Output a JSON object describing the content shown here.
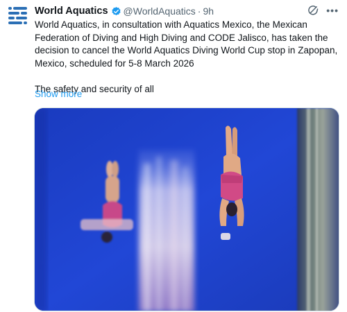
{
  "post": {
    "author_name": "World Aquatics",
    "handle": "@WorldAquatics",
    "separator": "·",
    "time": "9h",
    "paragraph_1": "World Aquatics, in consultation with Aquatics Mexico, the Mexican Federation of Diving and High Diving and CODE Jalisco, has taken the decision to cancel the World Aquatics Diving World Cup stop in Zapopan, Mexico, scheduled for 5-8 March 2026",
    "paragraph_2": "The safety and security of all",
    "show_more": "Show more"
  },
  "icons": {
    "avatar": "world-aquatics-logo",
    "verified": "verified-badge-icon",
    "grok": "grok-icon",
    "more": "more-icon"
  },
  "colors": {
    "link": "#1d9bf0",
    "verified": "#1d9bf0",
    "logo": "#2b6fb5",
    "muted": "#536471",
    "photo_background": "#1c3fc6",
    "swimsuit": "#d14a86"
  }
}
